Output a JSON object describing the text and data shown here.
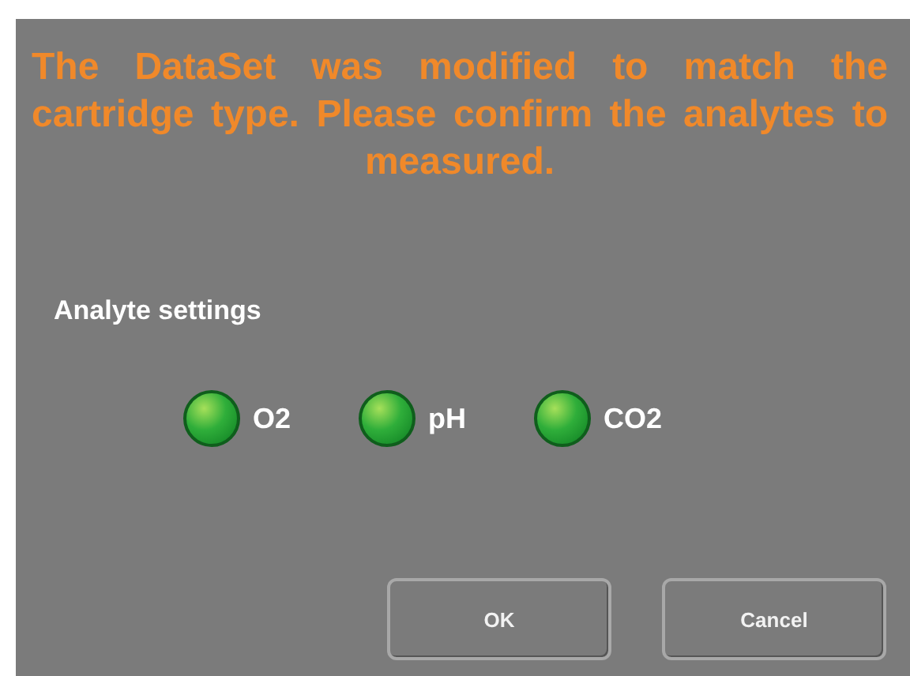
{
  "message": "The DataSet was modified to match the cartridge type. Please confirm the analytes to measured.",
  "section_title": "Analyte settings",
  "analytes": [
    {
      "label": "O2",
      "on": true
    },
    {
      "label": "pH",
      "on": true
    },
    {
      "label": "CO2",
      "on": true
    }
  ],
  "buttons": [
    {
      "label": "OK"
    },
    {
      "label": "Cancel"
    }
  ]
}
